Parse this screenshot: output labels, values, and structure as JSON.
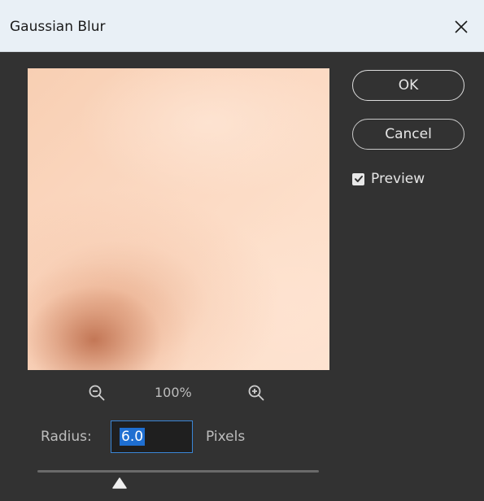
{
  "dialog": {
    "title": "Gaussian Blur",
    "close_icon": "close-icon"
  },
  "buttons": {
    "ok_label": "OK",
    "cancel_label": "Cancel"
  },
  "preview": {
    "label": "Preview",
    "checked": true
  },
  "zoom": {
    "level": "100%",
    "zoom_out_icon": "zoom-out-icon",
    "zoom_in_icon": "zoom-in-icon"
  },
  "radius": {
    "label": "Radius:",
    "value": "6.0",
    "units": "Pixels"
  },
  "slider": {
    "value": 6.0
  },
  "colors": {
    "title_bar": "#e9f0f6",
    "dialog_bg": "#323232",
    "accent": "#1f6fd1",
    "focus_border": "#3a86d6"
  }
}
